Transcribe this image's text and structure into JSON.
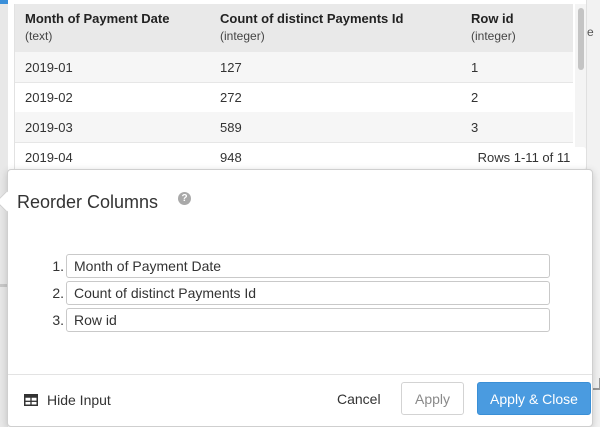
{
  "table": {
    "columns": [
      {
        "name": "Month of Payment Date",
        "type": "(text)"
      },
      {
        "name": "Count of distinct Payments Id",
        "type": "(integer)"
      },
      {
        "name": "Row id",
        "type": "(integer)"
      }
    ],
    "rows": [
      [
        "2019-01",
        "127",
        "1"
      ],
      [
        "2019-02",
        "272",
        "2"
      ],
      [
        "2019-03",
        "589",
        "3"
      ],
      [
        "2019-04",
        "948",
        ""
      ]
    ],
    "rows_info": "Rows 1-11 of 11"
  },
  "popover": {
    "title": "Reorder Columns",
    "help_glyph": "?",
    "columns": [
      {
        "number": "1.",
        "value": "Month of Payment Date"
      },
      {
        "number": "2.",
        "value": "Count of distinct Payments Id"
      },
      {
        "number": "3.",
        "value": "Row id"
      }
    ],
    "footer": {
      "hide_input_label": "Hide Input",
      "cancel_label": "Cancel",
      "apply_label": "Apply",
      "apply_close_label": "Apply & Close"
    }
  },
  "side_panel": {
    "glyph": "e"
  },
  "colors": {
    "accent": "#4a9be0",
    "header_bg": "#e9e9e9"
  }
}
